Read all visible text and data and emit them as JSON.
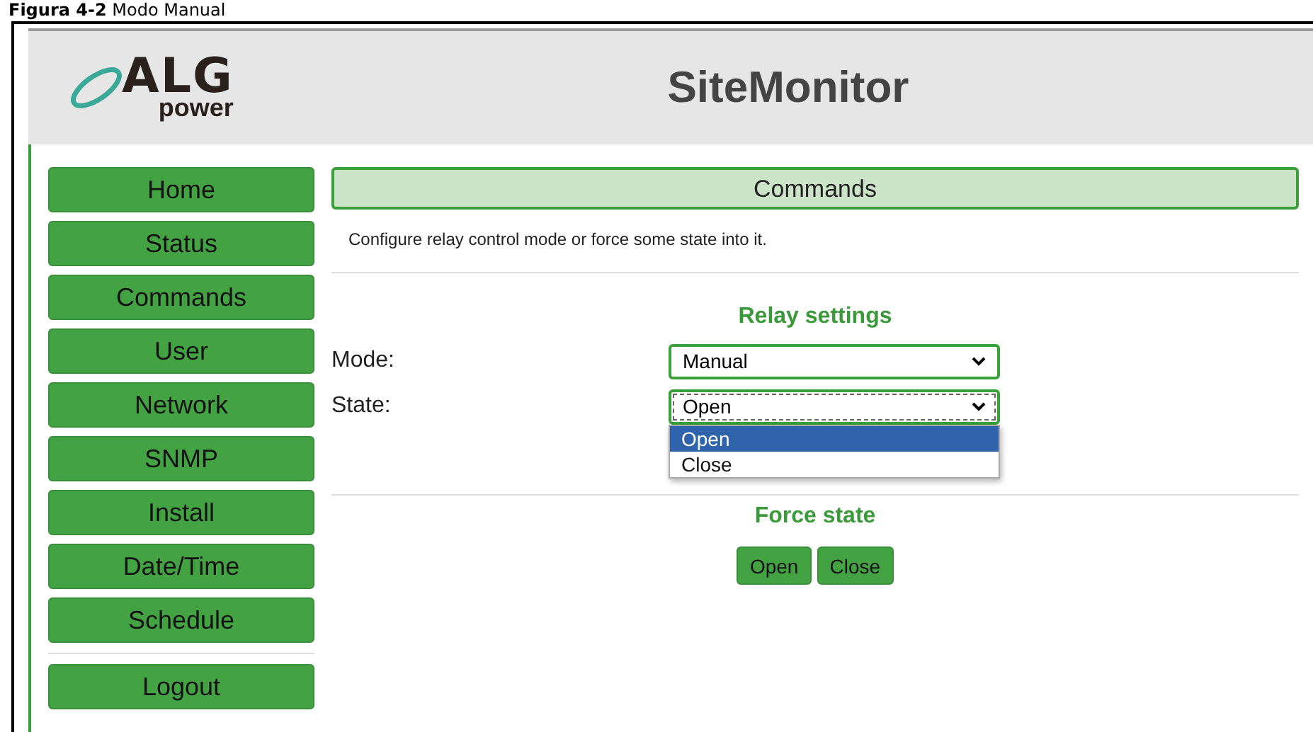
{
  "caption": {
    "figure": "Figura 4-2",
    "title": "Modo Manual"
  },
  "header": {
    "logo": {
      "brand": "ALG",
      "sub": "power"
    },
    "title": "SiteMonitor"
  },
  "sidebar": {
    "items": [
      {
        "label": "Home"
      },
      {
        "label": "Status"
      },
      {
        "label": "Commands"
      },
      {
        "label": "User"
      },
      {
        "label": "Network"
      },
      {
        "label": "SNMP"
      },
      {
        "label": "Install"
      },
      {
        "label": "Date/Time"
      },
      {
        "label": "Schedule"
      }
    ],
    "logout": "Logout"
  },
  "page": {
    "heading": "Commands",
    "description": "Configure relay control mode or force some state into it.",
    "relay": {
      "title": "Relay settings",
      "fields": [
        {
          "label": "Mode:",
          "value": "Manual",
          "expanded": false
        },
        {
          "label": "State:",
          "value": "Open",
          "expanded": true,
          "options": [
            {
              "label": "Open",
              "selected": true
            },
            {
              "label": "Close",
              "selected": false
            }
          ]
        }
      ]
    },
    "force": {
      "title": "Force state",
      "buttons": [
        "Open",
        "Close"
      ]
    }
  }
}
